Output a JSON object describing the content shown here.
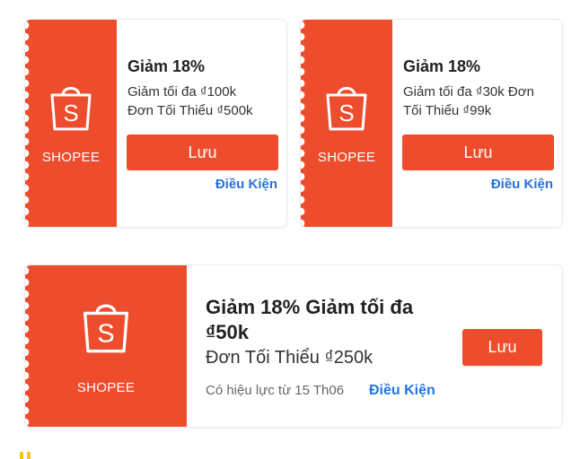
{
  "colors": {
    "accent": "#ee4d2d",
    "link": "#2673dd"
  },
  "vouchers": [
    {
      "brand": "SHOPEE",
      "icon": "shopping-bag-icon",
      "title": "Giảm 18%",
      "line1": "Giảm tối đa ₫100k",
      "line2": "Đơn Tối Thiểu ₫500k",
      "button": "Lưu",
      "terms": "Điều Kiện"
    },
    {
      "brand": "SHOPEE",
      "icon": "shopping-bag-icon",
      "title": "Giảm 18%",
      "line1": "Giảm tối đa ₫30k Đơn",
      "line2": "Tối Thiểu ₫99k",
      "button": "Lưu",
      "terms": "Điều Kiện"
    },
    {
      "brand": "SHOPEE",
      "icon": "shopping-bag-icon",
      "title_line1": "Giảm 18% Giảm tối đa",
      "title_line2": "₫50k",
      "subtitle": "Đơn Tối Thiểu ₫250k",
      "validity": "Có hiệu lực từ 15 Th06",
      "button": "Lưu",
      "terms": "Điều Kiện"
    }
  ]
}
